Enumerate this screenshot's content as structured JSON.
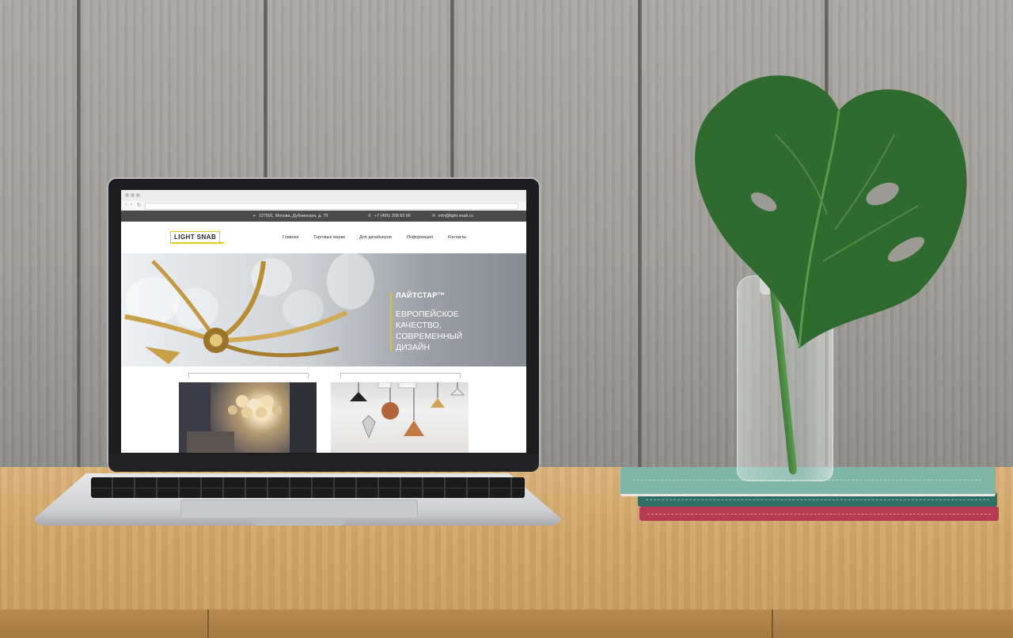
{
  "site": {
    "topbar": {
      "address": "127591, Москва, Дубнинская, д. 79",
      "phone": "+7 (495) 208 83 66",
      "email": "info@light-snab.ru"
    },
    "logo": "LIGHT SNAB",
    "nav": [
      "Главная",
      "Торговые марки",
      "Для дизайнеров",
      "Информация",
      "Контакты"
    ],
    "hero": {
      "title": "ЛАЙТСТАР™",
      "subtitle": "ЕВРОПЕЙСКОЕ КАЧЕСТВО, СОВРЕМЕННЫЙ ДИЗАЙН"
    }
  },
  "icons": {
    "address": "location-pin-icon",
    "phone": "phone-icon",
    "email": "mail-icon"
  },
  "colors": {
    "accent": "#e6c81a",
    "topbar": "#4a4a4a",
    "book_red": "#b73a55",
    "book_green": "#2f6f64",
    "book_mint": "#7fb5a6"
  }
}
